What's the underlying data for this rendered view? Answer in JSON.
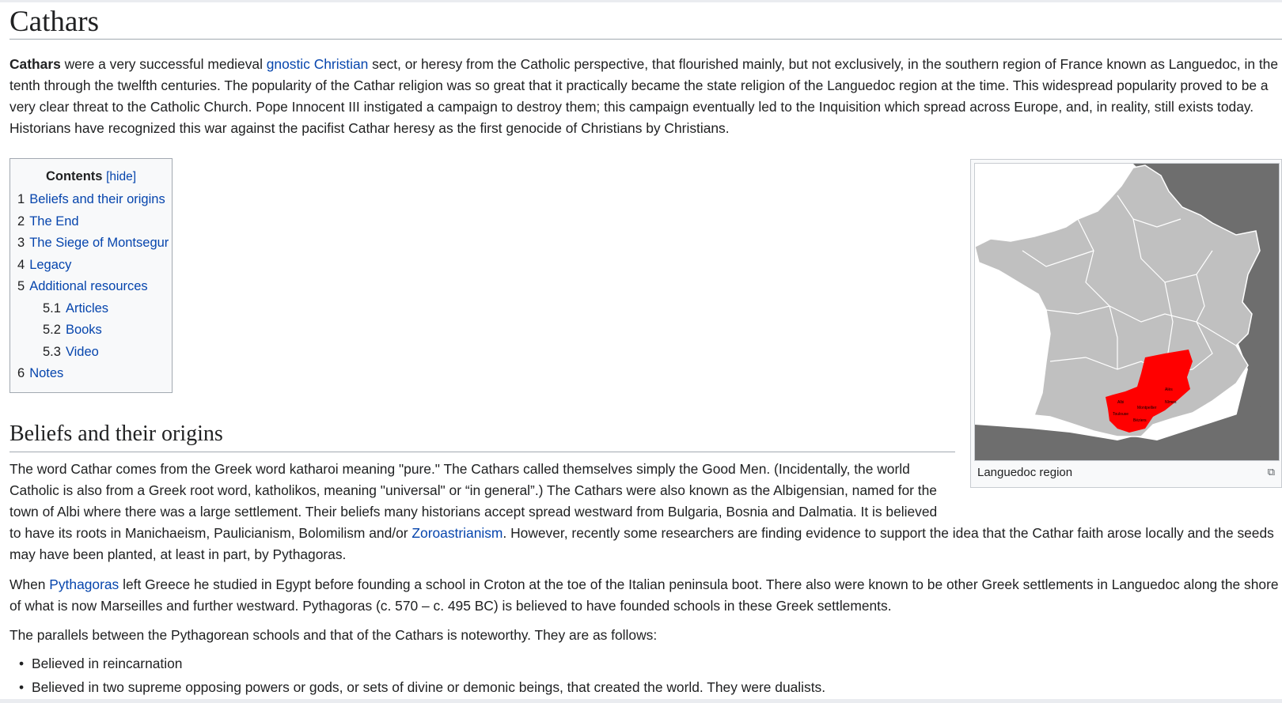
{
  "title": "Cathars",
  "intro": {
    "bold": "Cathars",
    "t1": " were a very successful medieval ",
    "link1": "gnostic Christian",
    "t2": " sect, or heresy from the Catholic perspective, that flourished mainly, but not exclusively, in the southern region of France known as Languedoc, in the tenth through the twelfth centuries. The popularity of the Cathar religion was so great that it practically became the state religion of the Languedoc region at the time. This widespread popularity proved to be a very clear threat to the Catholic Church. Pope Innocent III instigated a campaign to destroy them; this campaign eventually led to the Inquisition which spread across Europe, and, in reality, still exists today. Historians have recognized this war against the pacifist Cathar heresy as the first genocide of Christians by Christians."
  },
  "toc": {
    "title": "Contents",
    "hide_open": "[",
    "hide": "hide",
    "hide_close": "]",
    "items": [
      {
        "num": "1",
        "label": "Beliefs and their origins"
      },
      {
        "num": "2",
        "label": "The End"
      },
      {
        "num": "3",
        "label": "The Siege of Montsegur"
      },
      {
        "num": "4",
        "label": "Legacy"
      },
      {
        "num": "5",
        "label": "Additional resources"
      },
      {
        "num": "5.1",
        "label": "Articles"
      },
      {
        "num": "5.2",
        "label": "Books"
      },
      {
        "num": "5.3",
        "label": "Video"
      },
      {
        "num": "6",
        "label": "Notes"
      }
    ]
  },
  "figure": {
    "caption": "Languedoc region",
    "cities": [
      "Albi",
      "Nîmes",
      "Montpellier",
      "Toulouse",
      "Béziers",
      "Alès"
    ],
    "colors": {
      "region": "#ff0000",
      "land": "#c0c0c0",
      "sea": "#ffffff",
      "neighbors": "#6e6e6e"
    }
  },
  "section": {
    "heading": "Beliefs and their origins",
    "p1": {
      "l1": "The word Cathar comes from the Greek word katharoi meaning \"pure.\" The Cathars called themselves simply the Good Men. (Incidentally, the world",
      "l2": "Catholic is also from a Greek root word, katholikos, meaning \"universal\" or “in general”.) The Cathars were also known as the Albigensian, named for the",
      "l3": "town of Albi where there was a large settlement. Their beliefs many historians accept spread westward from Bulgaria, Bosnia and Dalmatia. It is believed",
      "l4a": "to have its roots in Manichaeism, Paulicianism, Bolomilism and/or ",
      "l4link": "Zoroastrianism",
      "l4b": ". However, recently some researchers are finding evidence to support the idea that the Cathar faith arose locally and the seeds",
      "l5": "may have been planted, at least in part, by Pythagoras."
    },
    "p2": {
      "t1": "When ",
      "link": "Pythagoras",
      "t2": " left Greece he studied in Egypt before founding a school in Croton at the toe of the Italian peninsula boot. There also were known to be other Greek settlements in Languedoc along the shore of what is now Marseilles and further westward. Pythagoras (c. 570 – c. 495 BC) is believed to have founded schools in these Greek settlements."
    },
    "p3": "The parallels between the Pythagorean schools and that of the Cathars is noteworthy. They are as follows:",
    "bullets": [
      "Believed in reincarnation",
      "Believed in two supreme opposing powers or gods, or sets of divine or demonic beings, that created the world. They were dualists."
    ]
  }
}
